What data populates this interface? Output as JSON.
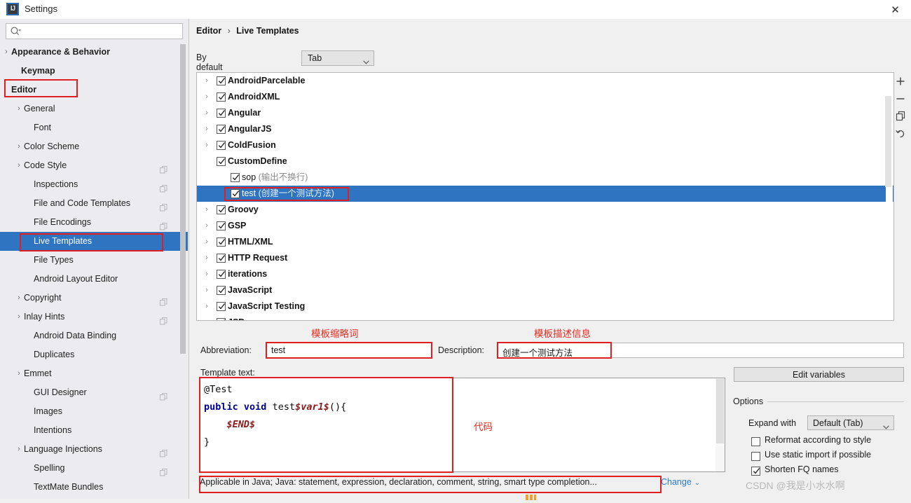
{
  "window": {
    "title": "Settings",
    "icon": "intellij-idea-icon",
    "close_label": "✕"
  },
  "search": {
    "placeholder": "",
    "value": "",
    "icon": "search-icon"
  },
  "sidebar": {
    "items": [
      {
        "label": "Appearance & Behavior",
        "arrow": "›",
        "indent": 16,
        "bold": true,
        "copy": false,
        "selected": false
      },
      {
        "label": "Keymap",
        "arrow": "",
        "indent": 30,
        "bold": true,
        "copy": false,
        "selected": false
      },
      {
        "label": "Editor",
        "arrow": "ⱟ",
        "indent": 16,
        "bold": true,
        "copy": false,
        "selected": false
      },
      {
        "label": "General",
        "arrow": "›",
        "indent": 34,
        "bold": false,
        "copy": false,
        "selected": false
      },
      {
        "label": "Font",
        "arrow": "",
        "indent": 48,
        "bold": false,
        "copy": false,
        "selected": false
      },
      {
        "label": "Color Scheme",
        "arrow": "›",
        "indent": 34,
        "bold": false,
        "copy": false,
        "selected": false
      },
      {
        "label": "Code Style",
        "arrow": "›",
        "indent": 34,
        "bold": false,
        "copy": true,
        "selected": false
      },
      {
        "label": "Inspections",
        "arrow": "",
        "indent": 48,
        "bold": false,
        "copy": true,
        "selected": false
      },
      {
        "label": "File and Code Templates",
        "arrow": "",
        "indent": 48,
        "bold": false,
        "copy": true,
        "selected": false
      },
      {
        "label": "File Encodings",
        "arrow": "",
        "indent": 48,
        "bold": false,
        "copy": true,
        "selected": false
      },
      {
        "label": "Live Templates",
        "arrow": "",
        "indent": 48,
        "bold": false,
        "copy": false,
        "selected": true
      },
      {
        "label": "File Types",
        "arrow": "",
        "indent": 48,
        "bold": false,
        "copy": false,
        "selected": false
      },
      {
        "label": "Android Layout Editor",
        "arrow": "",
        "indent": 48,
        "bold": false,
        "copy": false,
        "selected": false
      },
      {
        "label": "Copyright",
        "arrow": "›",
        "indent": 34,
        "bold": false,
        "copy": true,
        "selected": false
      },
      {
        "label": "Inlay Hints",
        "arrow": "›",
        "indent": 34,
        "bold": false,
        "copy": true,
        "selected": false
      },
      {
        "label": "Android Data Binding",
        "arrow": "",
        "indent": 48,
        "bold": false,
        "copy": false,
        "selected": false
      },
      {
        "label": "Duplicates",
        "arrow": "",
        "indent": 48,
        "bold": false,
        "copy": false,
        "selected": false
      },
      {
        "label": "Emmet",
        "arrow": "›",
        "indent": 34,
        "bold": false,
        "copy": false,
        "selected": false
      },
      {
        "label": "GUI Designer",
        "arrow": "",
        "indent": 48,
        "bold": false,
        "copy": true,
        "selected": false
      },
      {
        "label": "Images",
        "arrow": "",
        "indent": 48,
        "bold": false,
        "copy": false,
        "selected": false
      },
      {
        "label": "Intentions",
        "arrow": "",
        "indent": 48,
        "bold": false,
        "copy": false,
        "selected": false
      },
      {
        "label": "Language Injections",
        "arrow": "›",
        "indent": 34,
        "bold": false,
        "copy": true,
        "selected": false
      },
      {
        "label": "Spelling",
        "arrow": "",
        "indent": 48,
        "bold": false,
        "copy": true,
        "selected": false
      },
      {
        "label": "TextMate Bundles",
        "arrow": "",
        "indent": 48,
        "bold": false,
        "copy": false,
        "selected": false
      }
    ]
  },
  "breadcrumb": {
    "root": "Editor",
    "separator": "›",
    "current": "Live Templates"
  },
  "expand_row": {
    "label": "By default expand with",
    "value": "Tab"
  },
  "template_tree": {
    "rows": [
      {
        "arrow": "›",
        "indent": 28,
        "checked": true,
        "label": "AndroidParcelable",
        "desc": "",
        "child": false,
        "selected": false
      },
      {
        "arrow": "›",
        "indent": 28,
        "checked": true,
        "label": "AndroidXML",
        "desc": "",
        "child": false,
        "selected": false
      },
      {
        "arrow": "›",
        "indent": 28,
        "checked": true,
        "label": "Angular",
        "desc": "",
        "child": false,
        "selected": false
      },
      {
        "arrow": "›",
        "indent": 28,
        "checked": true,
        "label": "AngularJS",
        "desc": "",
        "child": false,
        "selected": false
      },
      {
        "arrow": "›",
        "indent": 28,
        "checked": true,
        "label": "ColdFusion",
        "desc": "",
        "child": false,
        "selected": false
      },
      {
        "arrow": "ⱟ",
        "indent": 28,
        "checked": true,
        "label": "CustomDefine",
        "desc": "",
        "child": false,
        "selected": false
      },
      {
        "arrow": "",
        "indent": 48,
        "checked": true,
        "label": "sop",
        "desc": " (输出不换行)",
        "child": true,
        "selected": false
      },
      {
        "arrow": "",
        "indent": 48,
        "checked": true,
        "label": "test",
        "desc": " (创建一个测试方法)",
        "child": true,
        "selected": true
      },
      {
        "arrow": "›",
        "indent": 28,
        "checked": true,
        "label": "Groovy",
        "desc": "",
        "child": false,
        "selected": false
      },
      {
        "arrow": "›",
        "indent": 28,
        "checked": true,
        "label": "GSP",
        "desc": "",
        "child": false,
        "selected": false
      },
      {
        "arrow": "›",
        "indent": 28,
        "checked": true,
        "label": "HTML/XML",
        "desc": "",
        "child": false,
        "selected": false
      },
      {
        "arrow": "›",
        "indent": 28,
        "checked": true,
        "label": "HTTP Request",
        "desc": "",
        "child": false,
        "selected": false
      },
      {
        "arrow": "›",
        "indent": 28,
        "checked": true,
        "label": "iterations",
        "desc": "",
        "child": false,
        "selected": false
      },
      {
        "arrow": "›",
        "indent": 28,
        "checked": true,
        "label": "JavaScript",
        "desc": "",
        "child": false,
        "selected": false
      },
      {
        "arrow": "›",
        "indent": 28,
        "checked": true,
        "label": "JavaScript Testing",
        "desc": "",
        "child": false,
        "selected": false
      },
      {
        "arrow": "›",
        "indent": 28,
        "checked": true,
        "label": "JSP",
        "desc": "",
        "child": false,
        "selected": false
      }
    ]
  },
  "tree_toolbar": {
    "add": "+",
    "remove": "−",
    "duplicate": "duplicate-icon",
    "revert": "revert-icon"
  },
  "abbreviation": {
    "label": "Abbreviation:",
    "value": "test"
  },
  "description": {
    "label": "Description:",
    "value": "创建一个测试方法"
  },
  "template_text": {
    "label": "Template text:",
    "line1": "@Test",
    "line2_kw1": "public",
    "line2_kw2": "void",
    "line2_name": "test",
    "line2_var": "$var1$",
    "line2_tail": "(){",
    "line3_var": "$END$",
    "line4": "}"
  },
  "options": {
    "edit_variables": "Edit variables",
    "title": "Options",
    "expand_with_label": "Expand with",
    "expand_with_value": "Default (Tab)",
    "checkboxes": [
      {
        "label": "Reformat according to style",
        "checked": false
      },
      {
        "label": "Use static import if possible",
        "checked": false
      },
      {
        "label": "Shorten FQ names",
        "checked": true
      }
    ]
  },
  "applicable": {
    "text": "Applicable in Java; Java: statement, expression, declaration, comment, string, smart type completion...",
    "change_label": "Change",
    "change_chevron": "⌄"
  },
  "annotations": {
    "abbrev_note": "模板缩略词",
    "desc_note": "模板描述信息",
    "code_note": "代码",
    "box_color": "#e02020",
    "text_color": "#ea2a1f"
  },
  "watermark": {
    "text": "CSDN @我是小水水啊"
  },
  "colors": {
    "accent_blue": "#2f74c0",
    "link_blue": "#2a7ad4",
    "panel_bg": "#f0f0f0",
    "sidebar_bg": "#ececf0"
  }
}
